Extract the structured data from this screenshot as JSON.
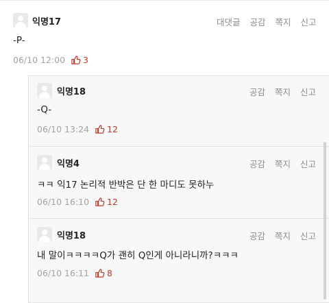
{
  "main_comment": {
    "author": "익명17",
    "text": "-P-",
    "timestamp": "06/10 12:00",
    "likes": "3",
    "actions": [
      "대댓글",
      "공감",
      "쪽지",
      "신고"
    ]
  },
  "replies": [
    {
      "author": "익명18",
      "text": "-Q-",
      "timestamp": "06/10 13:24",
      "likes": "12",
      "actions": [
        "공감",
        "쪽지",
        "신고"
      ]
    },
    {
      "author": "익명4",
      "text": "ㅋㅋ 익17 논리적 반박은 단 한 마디도 못하누",
      "timestamp": "06/10 16:10",
      "likes": "12",
      "actions": [
        "공감",
        "쪽지",
        "신고"
      ]
    },
    {
      "author": "익명18",
      "text": "내 말이ㅋㅋㅋㅋQ가 괜히 Q인게 아니라니까?ㅋㅋㅋ",
      "timestamp": "06/10 16:11",
      "likes": "8",
      "actions": [
        "공감",
        "쪽지",
        "신고"
      ]
    }
  ],
  "colors": {
    "like_red": "#c0392b",
    "reply_bg": "#f8f8f8",
    "border": "#e2e2e2"
  },
  "icons": {
    "avatar": "anonymous-avatar-icon",
    "like": "thumbs-up-icon"
  }
}
